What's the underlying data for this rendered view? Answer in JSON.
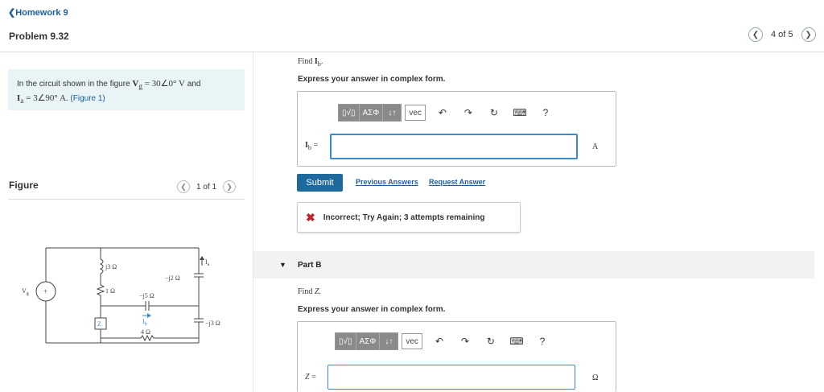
{
  "header": {
    "homework_link": "Homework 9",
    "problem_title": "Problem 9.32",
    "page_count": "4 of 5"
  },
  "given": {
    "lead": "In the circuit shown in the figure ",
    "vg_eq": "V",
    "vg_sub": "g",
    "vg_rhs": " = 30∠0° V",
    "and": " and",
    "ia_eq": "I",
    "ia_sub": "a",
    "ia_rhs": " = 3∠90° A. ",
    "figure_link": "(Figure 1)"
  },
  "figure": {
    "label": "Figure",
    "count": "1 of 1",
    "circuit_labels": {
      "vg": "V",
      "vg_sub": "g",
      "r_j3": "j3 Ω",
      "r_1": "1 Ω",
      "c_j2": "−j2 Ω",
      "c_j5": "−j5 Ω",
      "c_j3": "−j3 Ω",
      "r_4": "4 Ω",
      "ia": "I",
      "ia_sub": "a",
      "ib": "I",
      "ib_sub": "b",
      "z": "Z"
    }
  },
  "part_a": {
    "find_prefix": "Find ",
    "find_var": "I",
    "find_sub": "b",
    "find_suffix": ".",
    "express": "Express your answer in complex form.",
    "toolbar": {
      "templates": "▯√▯",
      "greek": "ΑΣΦ",
      "arrows": "↓↑",
      "vec": "vec",
      "help": "?"
    },
    "answer_label": "I",
    "answer_sub": "b",
    "answer_eq": " =",
    "answer_value": "",
    "unit": "A",
    "submit": "Submit",
    "previous_answers": "Previous Answers",
    "request_answer": "Request Answer",
    "feedback": "Incorrect; Try Again; 3 attempts remaining"
  },
  "part_b": {
    "label": "Part B",
    "find_prefix": "Find ",
    "find_var": "Z",
    "find_suffix": ".",
    "express": "Express your answer in complex form.",
    "toolbar": {
      "templates": "▯√▯",
      "greek": "ΑΣΦ",
      "arrows": "↓↑",
      "vec": "vec",
      "help": "?"
    },
    "answer_label": "Z",
    "answer_eq": " =",
    "answer_value": "",
    "unit": "Ω"
  }
}
